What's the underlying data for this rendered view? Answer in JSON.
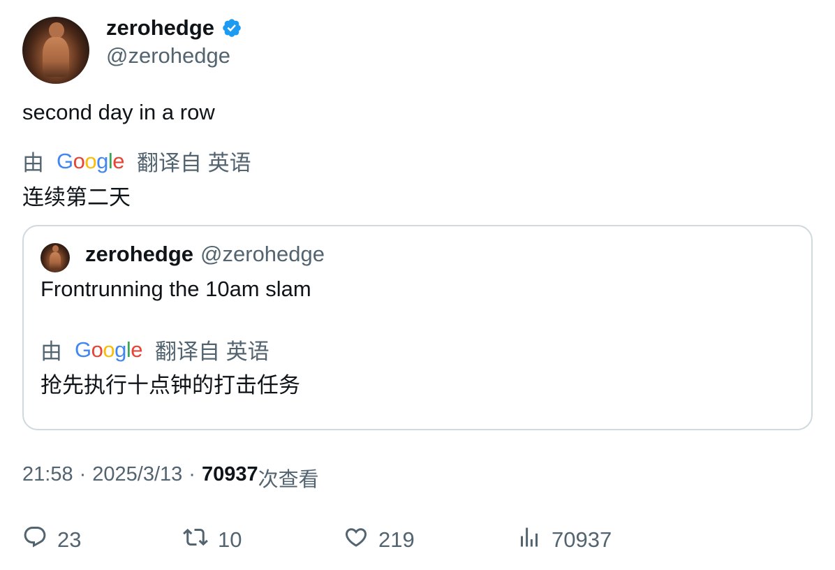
{
  "author": {
    "name": "zerohedge",
    "handle": "@zerohedge",
    "verified": true,
    "avatar_icon": "avatar-photo"
  },
  "tweet": {
    "text": "second day in a row",
    "translation": {
      "by_label": "由",
      "google_letters": [
        "G",
        "o",
        "o",
        "g",
        "l",
        "e"
      ],
      "from_label": "翻译自 英语",
      "text": "连续第二天"
    }
  },
  "quoted": {
    "name": "zerohedge",
    "handle": "@zerohedge",
    "text": "Frontrunning the 10am slam",
    "translation": {
      "by_label": "由",
      "from_label": "翻译自 英语",
      "text": "抢先执行十点钟的打击任务"
    }
  },
  "meta": {
    "time": "21:58",
    "sep1": "·",
    "date": "2025/3/13",
    "sep2": "·",
    "views": "70937",
    "views_label": "次查看"
  },
  "actions": {
    "replies": "23",
    "retweets": "10",
    "likes": "219",
    "views": "70937"
  },
  "colors": {
    "verified": "#1d9bf0",
    "muted": "#536471",
    "border": "#cfd9de"
  }
}
